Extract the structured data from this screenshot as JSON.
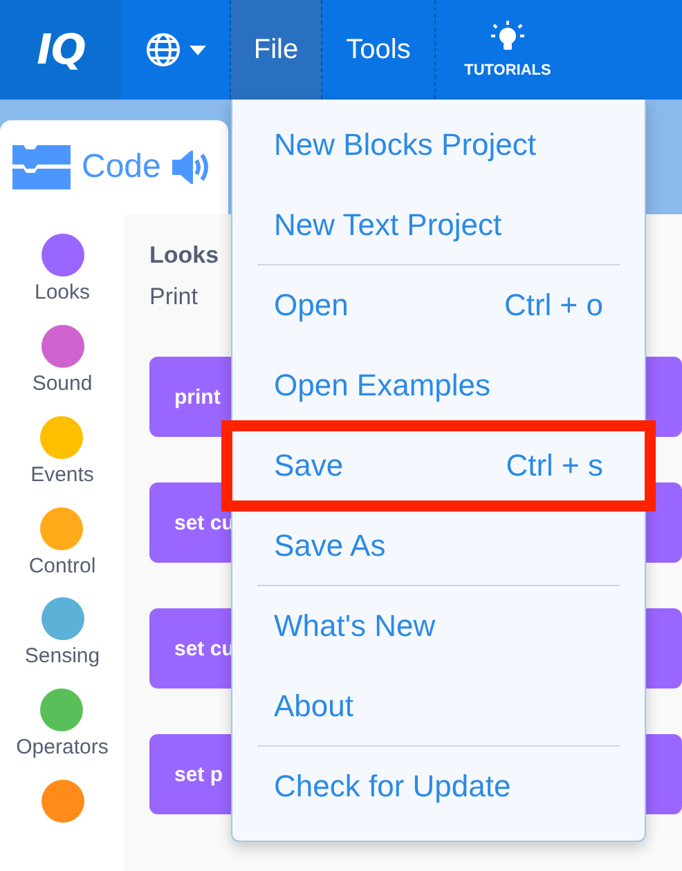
{
  "logo": "IQ",
  "menus": [
    {
      "label": "File",
      "selected": true
    },
    {
      "label": "Tools",
      "selected": false
    }
  ],
  "tutorials": "TUTORIALS",
  "code_tab": {
    "label": "Code"
  },
  "categories": [
    {
      "label": "Looks",
      "color": "#9966ff"
    },
    {
      "label": "Sound",
      "color": "#cf63cf"
    },
    {
      "label": "Events",
      "color": "#ffbf00"
    },
    {
      "label": "Control",
      "color": "#ffab19"
    },
    {
      "label": "Sensing",
      "color": "#5cb1d6"
    },
    {
      "label": "Operators",
      "color": "#59c059"
    },
    {
      "color": "#ff8c1a"
    }
  ],
  "palette": {
    "heading": "Looks",
    "subheading": "Print",
    "blocks": [
      {
        "label": "print"
      },
      {
        "label": "set cu"
      },
      {
        "label": "set cu"
      },
      {
        "label": "set p"
      }
    ]
  },
  "file_menu": {
    "items": [
      {
        "label": "New Blocks Project",
        "highlighted": false,
        "divider_after": false
      },
      {
        "label": "New Text Project",
        "highlighted": false,
        "divider_after": true
      },
      {
        "label": "Open",
        "shortcut": "Ctrl + o",
        "highlighted": false,
        "divider_after": false
      },
      {
        "label": "Open Examples",
        "highlighted": false,
        "divider_after": false
      },
      {
        "label": "Save",
        "shortcut": "Ctrl + s",
        "highlighted": true,
        "divider_after": false
      },
      {
        "label": "Save As",
        "highlighted": false,
        "divider_after": true
      },
      {
        "label": "What's New",
        "highlighted": false,
        "divider_after": false
      },
      {
        "label": "About",
        "highlighted": false,
        "divider_after": true
      },
      {
        "label": "Check for Update",
        "highlighted": false,
        "divider_after": false
      }
    ]
  }
}
